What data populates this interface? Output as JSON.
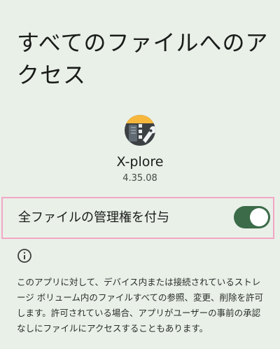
{
  "screen": {
    "title": "すべてのファイルへのアクセス"
  },
  "app": {
    "name": "X-plore",
    "version": "4.35.08",
    "icon": "x-plore-app-icon"
  },
  "permission": {
    "label": "全ファイルの管理権を付与",
    "enabled": true
  },
  "info": {
    "icon": "info-icon",
    "description": "このアプリに対して、デバイス内または接続されているストレージ ボリューム内のファイルすべての参照、変更、削除を許可します。許可されている場合、アプリがユーザーの事前の承認なしにファイルにアクセスすることもあります。"
  },
  "colors": {
    "background": "#e9f0e8",
    "toggle_on": "#3b6b48",
    "highlight_border": "#f2a7c6"
  }
}
